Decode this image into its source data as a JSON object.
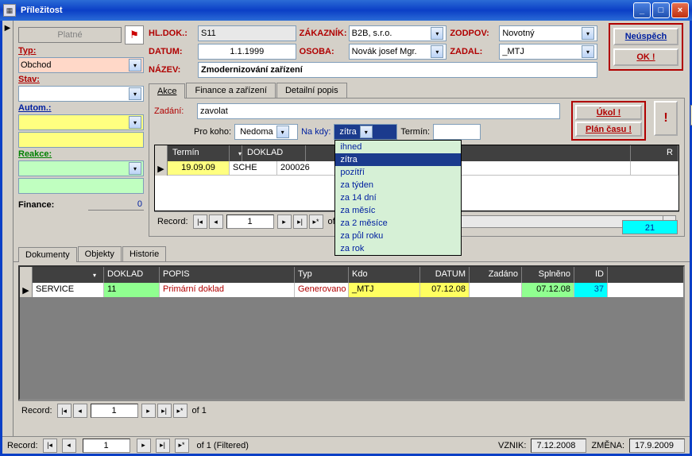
{
  "window": {
    "title": "Příležitost"
  },
  "sidebar": {
    "platne": "Platné",
    "typ_label": "Typ:",
    "typ_value": "Obchod",
    "stav_label": "Stav:",
    "autom_label": "Autom.:",
    "reakce_label": "Reakce:",
    "finance_label": "Finance:",
    "finance_value": "0"
  },
  "header": {
    "hl_dok_label": "HL.DOK.:",
    "hl_dok_value": "S11",
    "zakaznik_label": "ZÁKAZNÍK:",
    "zakaznik_value": "B2B, s.r.o.",
    "zodpov_label": "ZODPOV:",
    "zodpov_value": "Novotný",
    "datum_label": "DATUM:",
    "datum_value": "1.1.1999",
    "osoba_label": "OSOBA:",
    "osoba_value": "Novák josef Mgr.",
    "zadal_label": "ZADAL:",
    "zadal_value": "_MTJ",
    "nazev_label": "NÁZEV:",
    "nazev_value": "Zmodernizování zařízení"
  },
  "actions": {
    "neuspech": "Neúspěch",
    "ok": "OK !"
  },
  "tabs": {
    "akce": "Akce",
    "finance": "Finance a zařízení",
    "detail": "Detailní popis"
  },
  "akce": {
    "zadani_label": "Zadání:",
    "zadani_value": "zavolat",
    "pro_koho_label": "Pro koho:",
    "pro_koho_value": "Nedoma",
    "na_kdy_label": "Na kdy:",
    "na_kdy_value": "zítra",
    "termin_label": "Termín:",
    "ukol_btn": "Úkol !",
    "plan_btn": "Plán času !",
    "excl": "!",
    "grid_headers": {
      "termin": "Termín",
      "doklad": "DOKLAD",
      "r": "R"
    },
    "grid_row": {
      "termin": "19.09.09",
      "sche": "SCHE",
      "doklad": "200026"
    },
    "record_label": "Record:",
    "record_value": "1",
    "record_of": "of",
    "count_badge": "21"
  },
  "dropdown": {
    "items": [
      "ihned",
      "zítra",
      "pozítří",
      "za týden",
      "za 14 dní",
      "za měsíc",
      "za 2 měsíce",
      "za půl roku",
      "za rok"
    ],
    "selected": 1
  },
  "lower_tabs": {
    "dokumenty": "Dokumenty",
    "objekty": "Objekty",
    "historie": "Historie"
  },
  "big_grid": {
    "headers": {
      "doklad": "DOKLAD",
      "popis": "POPIS",
      "typ": "Typ",
      "kdo": "Kdo",
      "datum": "DATUM",
      "zadano": "Zadáno",
      "splneno": "Splněno",
      "id": "ID"
    },
    "row": {
      "type": "SERVICE",
      "doklad": "11",
      "popis": "Primární doklad",
      "typ": "Generovano",
      "kdo": "_MTJ",
      "datum": "07.12.08",
      "zadano": "",
      "splneno": "07.12.08",
      "id": "37"
    },
    "record_label": "Record:",
    "record_value": "1",
    "record_of": "of  1"
  },
  "bottom": {
    "record_label": "Record:",
    "record_value": "1",
    "record_of": "of 1 (Filtered)",
    "vznik_label": "VZNIK:",
    "vznik_value": "7.12.2008",
    "zmena_label": "ZMĚNA:",
    "zmena_value": "17.9.2009"
  }
}
